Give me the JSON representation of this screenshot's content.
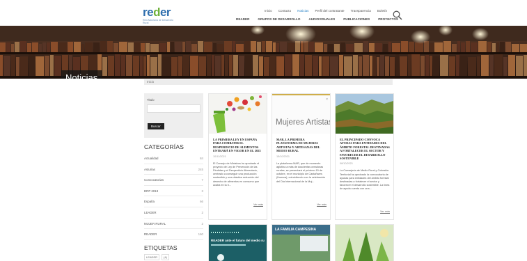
{
  "logo": {
    "word_a": "re",
    "word_g": "d",
    "word_b": "er",
    "tagline": "Red Asturiana de Desarrollo Rural"
  },
  "topnav": [
    "Inicio",
    "Contacto",
    "Noticias",
    "Perfil del contratante",
    "Transparencia",
    "Boletín"
  ],
  "topnav_active": 2,
  "mainnav": [
    "READER",
    "GRUPOS DE DESARROLLO",
    "AUDIOVISUALES",
    "PUBLICACIONES",
    "PROYECTOS"
  ],
  "hero": {
    "title": "Noticias"
  },
  "breadcrumb": "Inicio",
  "sidebar": {
    "search_label": "Titulo",
    "search_value": "",
    "search_button": "Buscar",
    "categories_title": "CATEGORÍAS",
    "categories": [
      {
        "name": "Actualidad",
        "count": "84"
      },
      {
        "name": "Asturias",
        "count": "245"
      },
      {
        "name": "Convocatorias",
        "count": "7"
      },
      {
        "name": "DRP 2019",
        "count": "3"
      },
      {
        "name": "España",
        "count": "66"
      },
      {
        "name": "LEADER",
        "count": "2"
      },
      {
        "name": "MUJER RURAL",
        "count": "2"
      },
      {
        "name": "READER",
        "count": "160"
      }
    ],
    "tags_title": "ETIQUETAS",
    "tags": [
      "LEADER",
      "(4)"
    ]
  },
  "cards": [
    {
      "title": "LA PRIMERA LEY EN ESPAÑA PARA COMBATIR EL DESPERDICIO DE ALIMENTOS ENTRARÁ EN VIGOR EN EL 2023",
      "date": "10/11/2021",
      "excerpt": "El Consejo de Ministros ha aprobado el proyecto de Ley de Prevención de las Pérdidas y el Desperdicio Alimentario, centrado a conseguir una producción sostenible y una drástica reducción del desecho de alimentos en consumo que acaba en la b...",
      "more": "Ver más"
    },
    {
      "image_text": "Mujeres Artistas",
      "title": "MAR, LA PRIMERA PLATAFORMA DE MUJERES ARTISTAS Y ARTESANAS DEL MEDIO RURAL",
      "date": "15/10/2021",
      "excerpt": "La plataforma MAR, que de momento aglutina a más de doscientas creadoras rurales, se presentará el próximo 15 de octubre, en el municipio de Castañares (Huesca), coincidiendo con la celebración del Día Internacional de la Muj...",
      "more": "Ver más"
    },
    {
      "title": "EL PRINCIPADO CONVOCA AYUDAS PARA ENTIDADES DEL ÁMBITO FORESTAL DESTINADAS A FORTALECER EL SECTOR Y FAVORECER EL DESARROLLO SOSTENIBLE",
      "date": "08/10/2021",
      "excerpt": "La Consejería de Medio Rural y Cohesión Territorial ha aprobado la convocatoria de ayudas para entidades del ámbito forestal destinadas a fortalecer el sector y favorecer el desarrollo sostenible. La línea de ayuda cuenta con una...",
      "more": "Ver más"
    }
  ],
  "cards_row2": [
    {
      "image_text": "READER ante el futuro del medio ru"
    },
    {
      "image_text": "LA FAMILIA CAMPESINA"
    },
    {
      "image_text": ""
    }
  ],
  "colors": {
    "brand_blue": "#2f6fae",
    "brand_green": "#6fb13a",
    "active_link": "#2f86c8"
  }
}
